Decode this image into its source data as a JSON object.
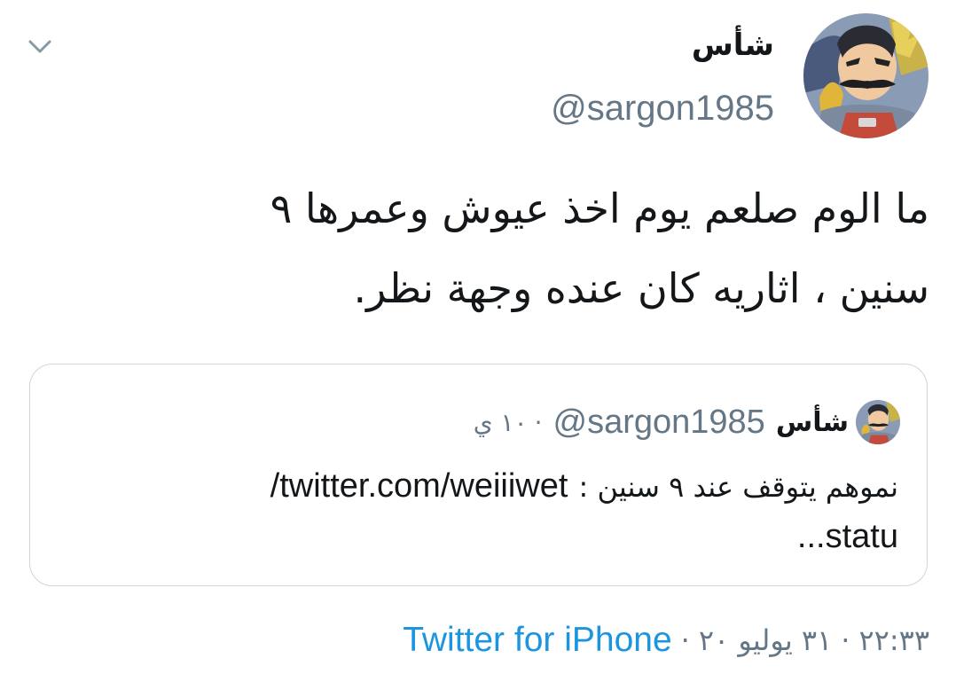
{
  "icons": {
    "menu": "chevron-down-icon"
  },
  "colors": {
    "text_primary": "#14171a",
    "text_secondary": "#657786",
    "link": "#1b95e0",
    "border": "#ccd6dd"
  },
  "tweet": {
    "author": {
      "display_name": "شأس",
      "handle": "@sargon1985"
    },
    "text_lines": [
      "ما الوم صلعم يوم اخذ عيوش وعمرها ٩",
      "سنين ، اثاريه كان عنده وجهة نظر."
    ],
    "quoted": {
      "display_name": "شأس",
      "handle": "@sargon1985",
      "separator": "·",
      "time": "١٠ ي",
      "text_arabic": "نموهم يتوقف عند ٩ سنين :",
      "text_link": "twitter.com/weiiiwet/",
      "text_link_cont": "statu..."
    },
    "meta": {
      "time": "٢٢:٣٣",
      "date": "٣١ يوليو ٢٠",
      "separator": "·",
      "source": "Twitter for iPhone"
    }
  }
}
